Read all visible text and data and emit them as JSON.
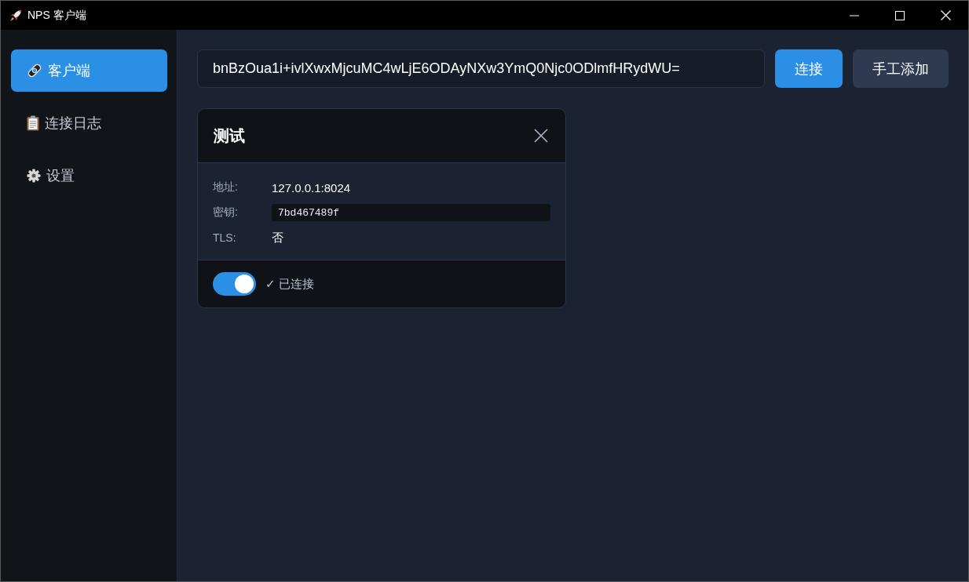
{
  "window": {
    "title": "NPS 客户端"
  },
  "sidebar": {
    "items": [
      {
        "label": "客户端",
        "selected": true
      },
      {
        "label": "连接日志",
        "selected": false
      },
      {
        "label": "设置",
        "selected": false
      }
    ]
  },
  "toolbar": {
    "input": {
      "value": "bnBzOua1i+ivlXwxMjcuMC4wLjE6ODAyNXw3YmQ0Njc0ODlmfHRydWU="
    },
    "buttons": [
      {
        "label": "连接",
        "kind": "primary"
      },
      {
        "label": "手工添加",
        "kind": "secondary"
      }
    ]
  },
  "clients": [
    {
      "name": "测试",
      "fields": [
        {
          "label": "地址:",
          "value": "127.0.0.1:8024",
          "kind": "text"
        },
        {
          "label": "密钥:",
          "value": "7bd467489f",
          "kind": "code"
        },
        {
          "label": "TLS:",
          "value": "否",
          "kind": "text"
        }
      ],
      "on": true,
      "status": "✓ 已连接"
    }
  ]
}
